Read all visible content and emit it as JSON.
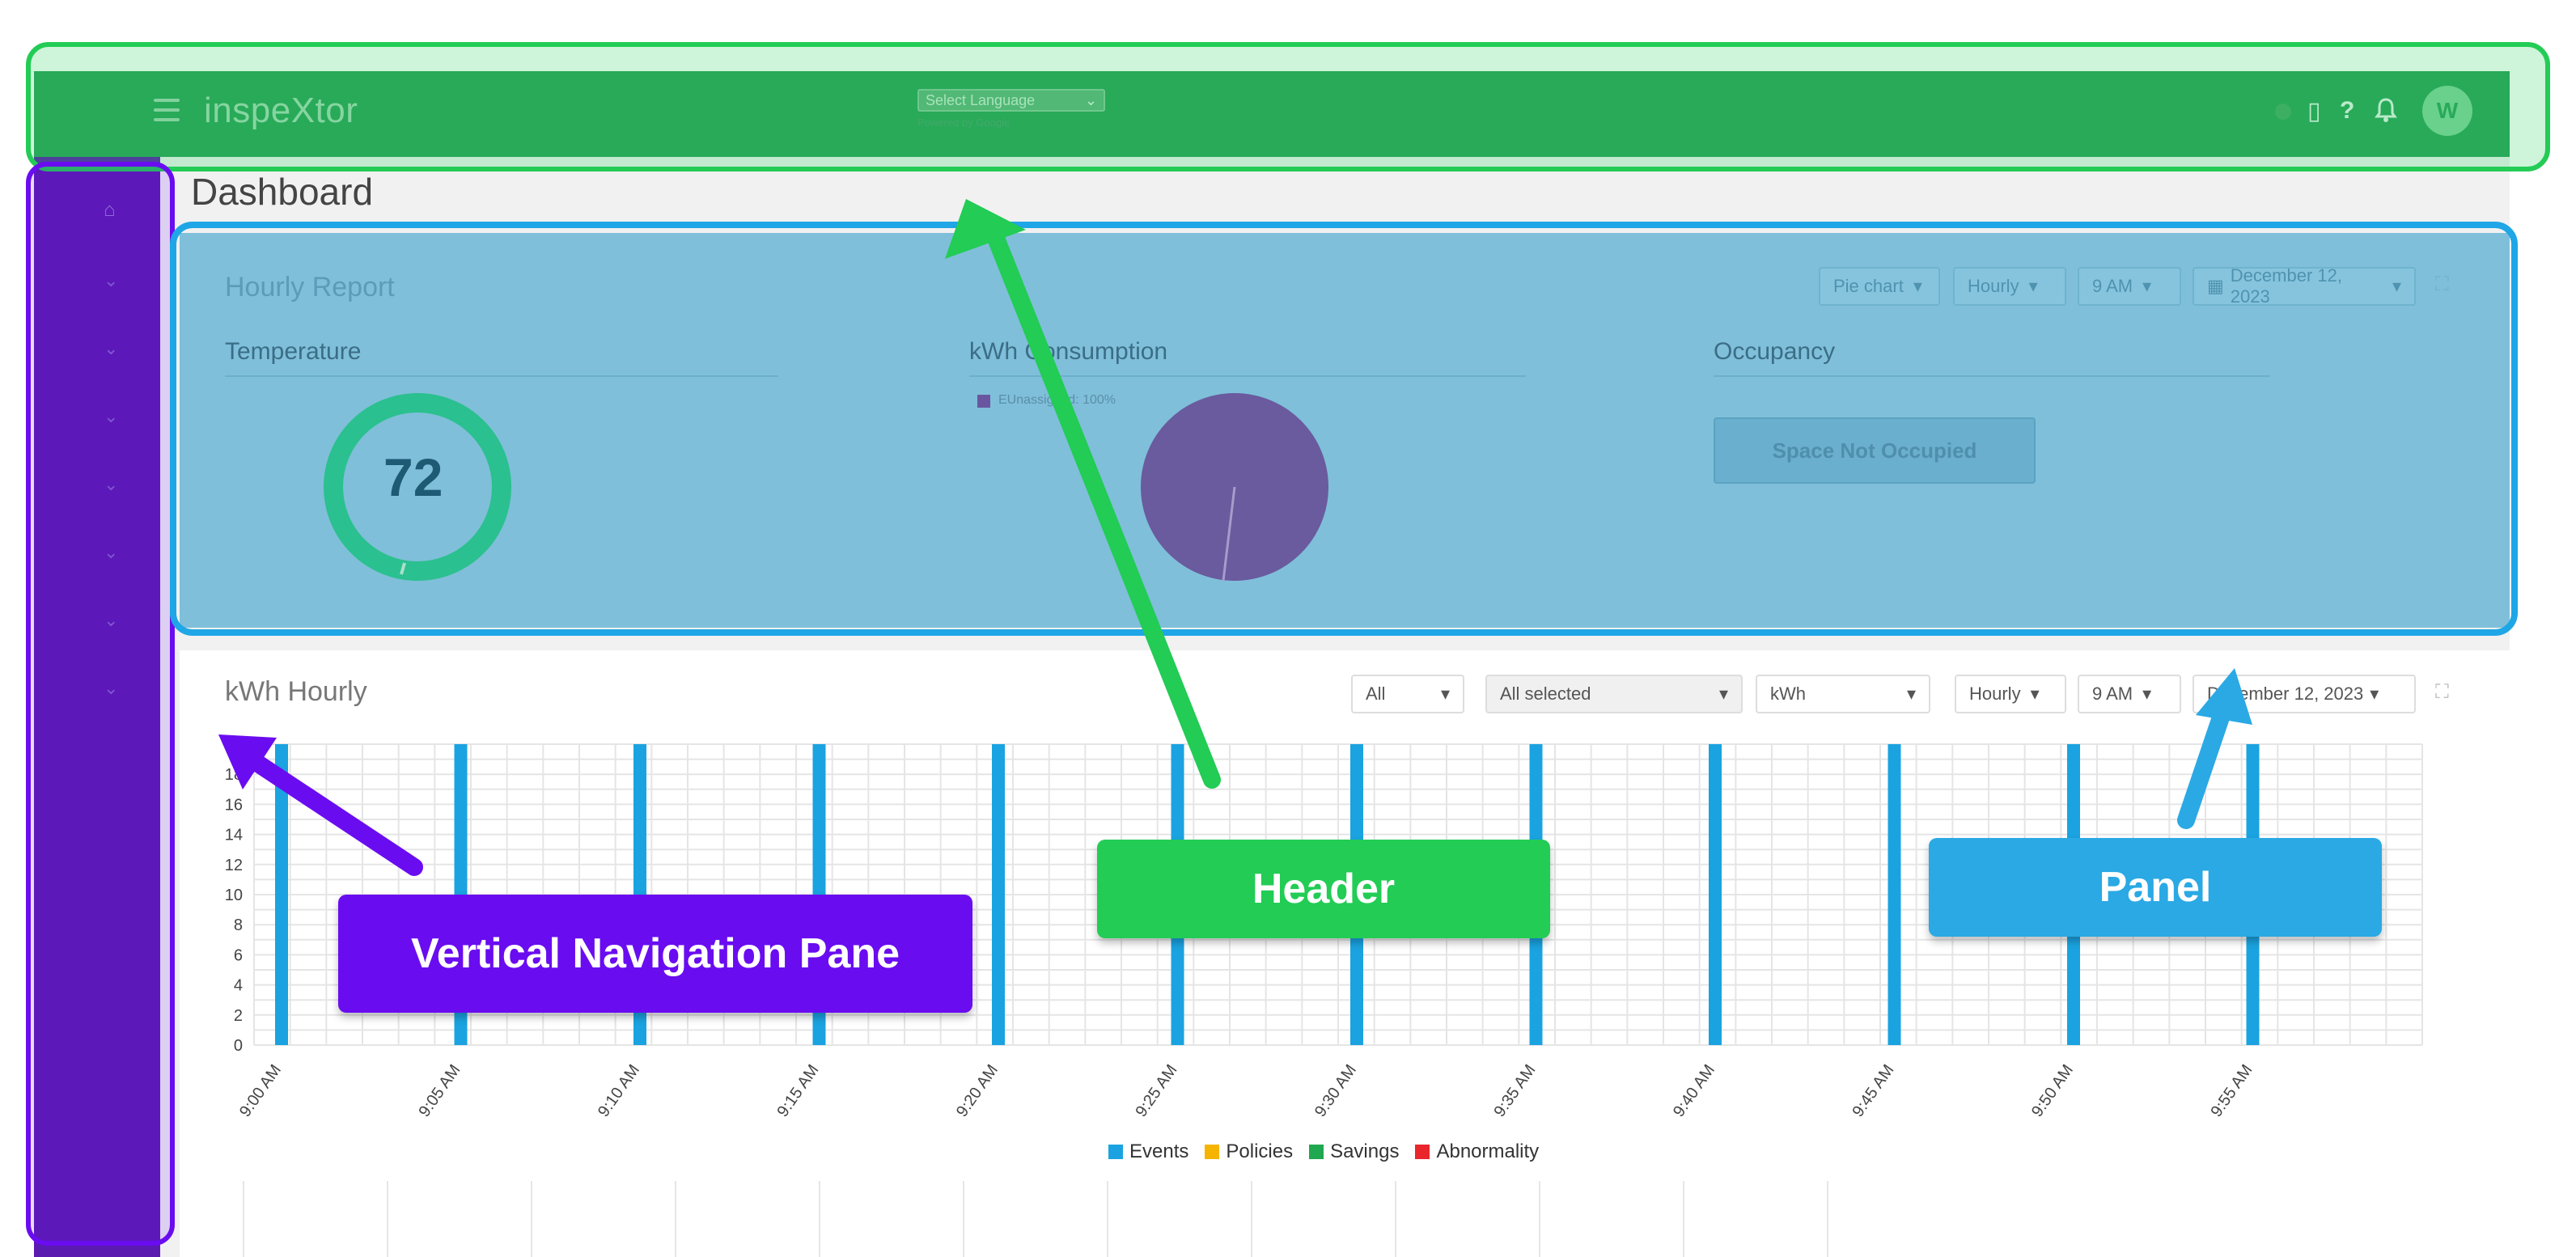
{
  "header": {
    "app_name": "inspeXtor",
    "language_select": "Select Language",
    "powered_by": "Powered by Google",
    "icons": [
      "menu-icon",
      "mobile-icon",
      "help-icon",
      "bell-icon",
      "user-avatar"
    ]
  },
  "page": {
    "title": "Dashboard"
  },
  "hourly_report": {
    "title": "Hourly Report",
    "controls": [
      "Pie chart",
      "Hourly",
      "9 AM",
      "December 12, 2023"
    ],
    "temperature": {
      "label": "Temperature",
      "value": "72"
    },
    "kwh_consumption": {
      "label": "kWh Consumption",
      "legend": "EUnassigned: 100%"
    },
    "occupancy": {
      "label": "Occupancy",
      "button": "Space Not Occupied"
    }
  },
  "kwh_hourly": {
    "title": "kWh Hourly",
    "controls": [
      "All",
      "All selected",
      "kWh",
      "Hourly",
      "9 AM",
      "December 12, 2023"
    ]
  },
  "chart_data": {
    "type": "bar",
    "categories": [
      "9:00 AM",
      "9:05 AM",
      "9:10 AM",
      "9:15 AM",
      "9:20 AM",
      "9:25 AM",
      "9:30 AM",
      "9:35 AM",
      "9:40 AM",
      "9:45 AM",
      "9:50 AM",
      "9:55 AM"
    ],
    "series": [
      {
        "name": "Events",
        "values": [
          20,
          20,
          20,
          20,
          20,
          20,
          20,
          20,
          20,
          20,
          20,
          20
        ]
      },
      {
        "name": "Policies",
        "values": [
          0,
          0,
          0,
          0,
          0,
          0,
          0,
          0,
          0,
          0,
          0,
          0
        ]
      },
      {
        "name": "Savings",
        "values": [
          0,
          0,
          0,
          0,
          0,
          0,
          0,
          0,
          0,
          0,
          0,
          0
        ]
      },
      {
        "name": "Abnormality",
        "values": [
          0,
          0,
          0,
          0,
          0,
          0,
          0,
          0,
          0,
          0,
          0,
          0
        ]
      }
    ],
    "y_ticks": [
      0,
      2,
      4,
      6,
      8,
      10,
      12,
      14,
      16,
      18
    ],
    "ylim": [
      0,
      20
    ],
    "grid": true,
    "legend_position": "bottom",
    "colors": {
      "Events": "#1aa3e0",
      "Policies": "#f4b400",
      "Savings": "#1fa84f",
      "Abnormality": "#e8262b"
    }
  },
  "callouts": {
    "nav": "Vertical Navigation Pane",
    "header": "Header",
    "panel": "Panel"
  },
  "colors": {
    "header": "#22cc55",
    "nav": "#6a0cf0",
    "panel": "#1fa6e6"
  }
}
